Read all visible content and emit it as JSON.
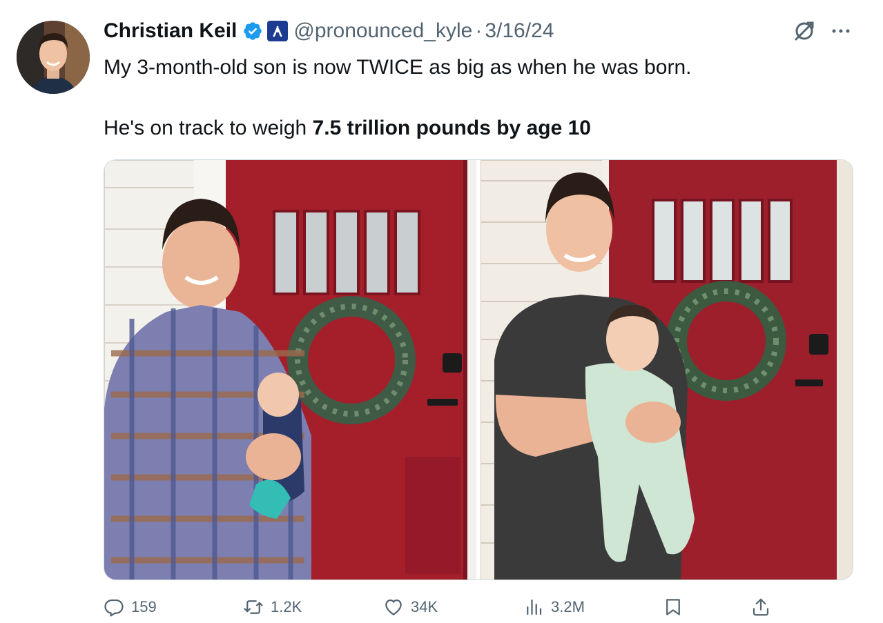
{
  "author": {
    "display_name": "Christian Keil",
    "handle": "@pronounced_kyle",
    "separator": "·",
    "date": "3/16/24",
    "verified": true,
    "affiliation_badge_icon": "affiliation-badge-icon"
  },
  "tweet": {
    "line1": "My 3-month-old son is now TWICE as big as when he was born.",
    "line2_plain": "He's on track to weigh ",
    "line2_bold": "7.5 trillion pounds by age 10"
  },
  "media": {
    "count": 2
  },
  "actions": {
    "replies": "159",
    "reposts": "1.2K",
    "likes": "34K",
    "views": "3.2M"
  },
  "colors": {
    "text": "#0f1419",
    "secondary": "#536471",
    "verified_blue": "#1d9bf0",
    "door_red": "#9b1f2c"
  }
}
